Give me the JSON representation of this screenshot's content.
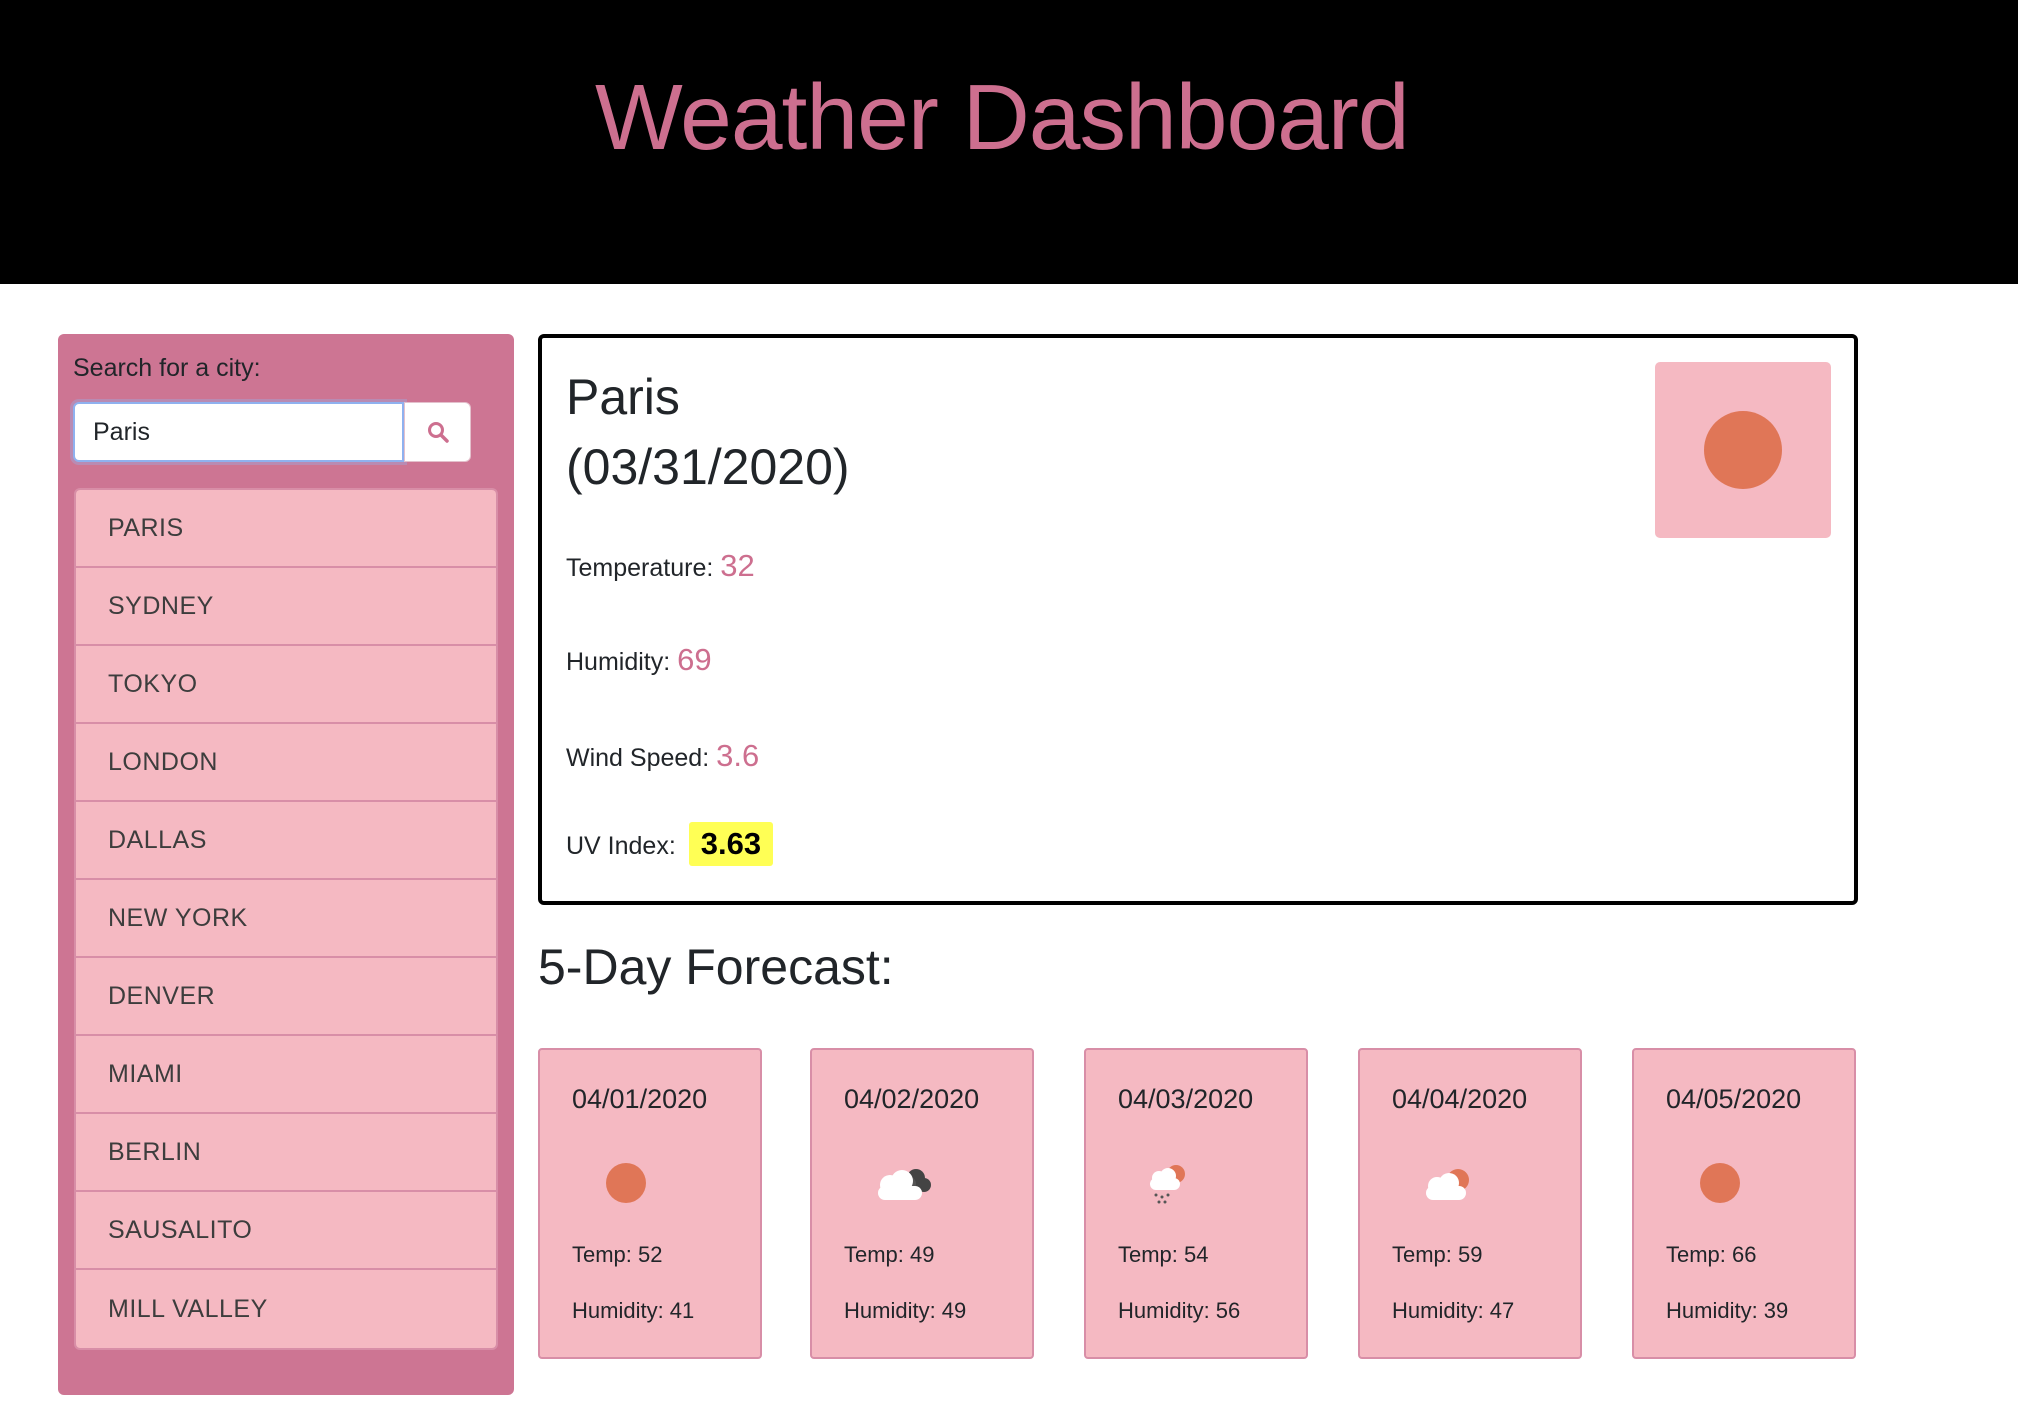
{
  "header": {
    "title": "Weather Dashboard"
  },
  "sidebar": {
    "search_label": "Search for a city:",
    "search_value": "Paris",
    "search_icon": "search-icon",
    "cities": [
      "PARIS",
      "SYDNEY",
      "TOKYO",
      "LONDON",
      "DALLAS",
      "NEW YORK",
      "DENVER",
      "MIAMI",
      "BERLIN",
      "SAUSALITO",
      "MILL VALLEY"
    ]
  },
  "current": {
    "city": "Paris",
    "date": "(03/31/2020)",
    "icon": "clear-sun-icon",
    "temperature_label": "Temperature:",
    "temperature": "32",
    "humidity_label": "Humidity:",
    "humidity": "69",
    "wind_label": "Wind Speed:",
    "wind": "3.6",
    "uv_label": "UV Index:",
    "uv": "3.63"
  },
  "forecast": {
    "title": "5-Day Forecast:",
    "days": [
      {
        "date": "04/01/2020",
        "icon": "clear-sun-icon",
        "temp": "Temp: 52",
        "humidity": "Humidity: 41"
      },
      {
        "date": "04/02/2020",
        "icon": "dark-cloud-icon",
        "temp": "Temp: 49",
        "humidity": "Humidity: 49"
      },
      {
        "date": "04/03/2020",
        "icon": "rain-cloud-sun-icon",
        "temp": "Temp: 54",
        "humidity": "Humidity: 56"
      },
      {
        "date": "04/04/2020",
        "icon": "partly-cloudy-icon",
        "temp": "Temp: 59",
        "humidity": "Humidity: 47"
      },
      {
        "date": "04/05/2020",
        "icon": "clear-sun-icon",
        "temp": "Temp: 66",
        "humidity": "Humidity: 39"
      }
    ]
  },
  "colors": {
    "accent": "#cd6f8f",
    "sidebar_bg": "#cd7593",
    "card_bg": "#f5b9c2",
    "sun": "#e07657",
    "uv_highlight": "#ffff55"
  }
}
